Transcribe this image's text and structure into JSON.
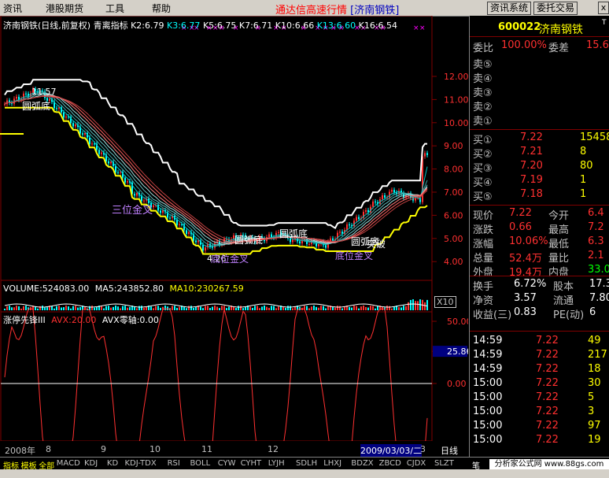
{
  "menu": {
    "items": [
      "资讯",
      "港股期货",
      "工具",
      "帮助"
    ],
    "window_title": "通达信高速行情",
    "stock_bracket": "[济南钢铁]",
    "buttons": [
      "资讯系统",
      "委托交易"
    ],
    "close": "x"
  },
  "header": {
    "name": "济南钢铁(日线,前复权)",
    "indicator": "青离指标",
    "values": [
      {
        "label": "K2:6.79",
        "color": "#ffffff"
      },
      {
        "label": "K3:6.77",
        "color": "#00ffff"
      },
      {
        "label": "K5:6.75",
        "color": "#ffffff"
      },
      {
        "label": "K7:6.71",
        "color": "#ffffff"
      },
      {
        "label": "K10:6.66",
        "color": "#ffffff"
      },
      {
        "label": "K13:6.60",
        "color": "#00ffff"
      },
      {
        "label": "K16:6.54",
        "color": "#ffffff"
      }
    ]
  },
  "price_axis": [
    "12.00",
    "11.00",
    "10.00",
    "9.00",
    "8.00",
    "7.00",
    "6.00",
    "5.00",
    "4.00"
  ],
  "price_annotations": {
    "high": "11.57",
    "low": "4.26",
    "labels": [
      "圆弧底",
      "三位金叉",
      "圆弧底",
      "圆弧底",
      "圆弧底",
      "底位金叉",
      "突破",
      "底位金叉"
    ]
  },
  "volume": {
    "volume": "VOLUME:524083.00",
    "ma5": "MA5:243852.80",
    "ma10": "MA10:230267.59",
    "scale": "X10"
  },
  "indicator2": {
    "name": "涨停先锋III",
    "avx": "AVX:20.00",
    "avx_zero": "AVX零轴:0.00",
    "axis": [
      "50.00",
      "25.86",
      "0.00",
      "-50.00"
    ]
  },
  "date_axis": {
    "labels": [
      "2008年",
      "8",
      "9",
      "10",
      "11",
      "12",
      "2009/03/03/二",
      "3"
    ],
    "period": "日线"
  },
  "bottom_tabs": [
    "指标",
    "模板",
    "全部",
    "MACD",
    "KDJ",
    "KD",
    "KDJ-TDX",
    "RSI",
    "BOLL",
    "CYW",
    "CYHT",
    "LYJH",
    "SDLH",
    "LHXJ",
    "BDZX",
    "ZBCD",
    "CJDX",
    "SLZT"
  ],
  "quote": {
    "code": "600022",
    "name": "济南钢铁",
    "weibi_label": "委比",
    "weibi_value": "100.00%",
    "weicha_label": "委差",
    "weicha_value": "15.6",
    "sells": [
      {
        "label": "卖⑤",
        "price": "",
        "vol": ""
      },
      {
        "label": "卖④",
        "price": "",
        "vol": ""
      },
      {
        "label": "卖③",
        "price": "",
        "vol": ""
      },
      {
        "label": "卖②",
        "price": "",
        "vol": ""
      },
      {
        "label": "卖①",
        "price": "",
        "vol": ""
      }
    ],
    "buys": [
      {
        "label": "买①",
        "price": "7.22",
        "vol": "15458"
      },
      {
        "label": "买②",
        "price": "7.21",
        "vol": "8"
      },
      {
        "label": "买③",
        "price": "7.20",
        "vol": "80"
      },
      {
        "label": "买④",
        "price": "7.19",
        "vol": "1"
      },
      {
        "label": "买⑤",
        "price": "7.18",
        "vol": "1"
      }
    ],
    "stats": [
      {
        "l1": "现价",
        "v1": "7.22",
        "l2": "今开",
        "v2": "6.4"
      },
      {
        "l1": "涨跌",
        "v1": "0.66",
        "l2": "最高",
        "v2": "7.2"
      },
      {
        "l1": "涨幅",
        "v1": "10.06%",
        "l2": "最低",
        "v2": "6.3"
      },
      {
        "l1": "总量",
        "v1": "52.4万",
        "l2": "量比",
        "v2": "2.1"
      },
      {
        "l1": "外盘",
        "v1": "19.4万",
        "l2": "内盘",
        "v2": "33.0"
      }
    ],
    "extra": [
      {
        "l1": "换手",
        "v1": "6.72%",
        "l2": "股本",
        "v2": "17.3"
      },
      {
        "l1": "净资",
        "v1": "3.57",
        "l2": "流通",
        "v2": "7.80"
      },
      {
        "l1": "收益(三)",
        "v1": "0.83",
        "l2": "PE(动)",
        "v2": "6"
      }
    ],
    "ticks": [
      {
        "time": "14:59",
        "price": "7.22",
        "vol": "49"
      },
      {
        "time": "14:59",
        "price": "7.22",
        "vol": "217"
      },
      {
        "time": "14:59",
        "price": "7.22",
        "vol": "18"
      },
      {
        "time": "15:00",
        "price": "7.22",
        "vol": "30"
      },
      {
        "time": "15:00",
        "price": "7.22",
        "vol": "5"
      },
      {
        "time": "15:00",
        "price": "7.22",
        "vol": "3"
      },
      {
        "time": "15:00",
        "price": "7.22",
        "vol": "97"
      },
      {
        "time": "15:00",
        "price": "7.22",
        "vol": "19"
      }
    ],
    "tab": "笔"
  },
  "watermark": "分析家公式网 www.88gs.com",
  "colors": {
    "up": "#ff3030",
    "down": "#00ffff",
    "yellow": "#ffff00",
    "white": "#ffffff",
    "grid": "#800000"
  }
}
